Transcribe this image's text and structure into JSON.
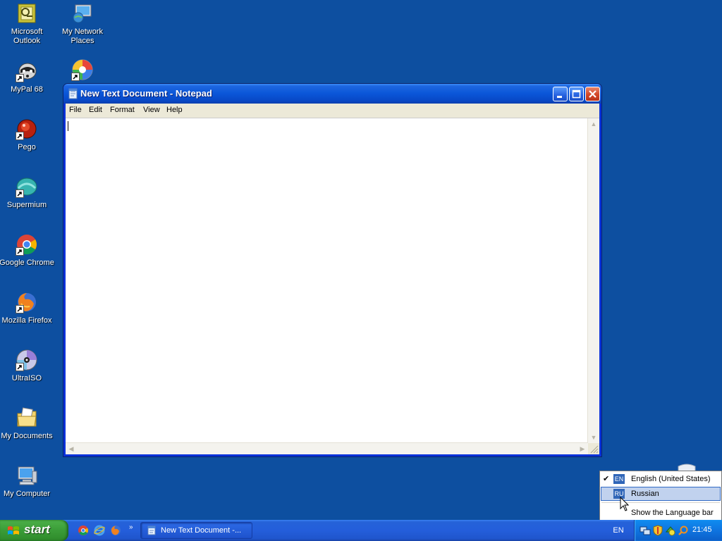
{
  "desktop": {
    "icons": [
      {
        "label": "Microsoft\nOutlook"
      },
      {
        "label": "My Network\nPlaces"
      },
      {
        "label": "MyPal 68"
      },
      {
        "label": ""
      },
      {
        "label": "Pego"
      },
      {
        "label": "Supermium"
      },
      {
        "label": "Google Chrome"
      },
      {
        "label": "Mozilla Firefox"
      },
      {
        "label": "UltraISO"
      },
      {
        "label": "My Documents"
      },
      {
        "label": "My Computer"
      }
    ]
  },
  "notepad": {
    "title": "New Text Document - Notepad",
    "menu": [
      "File",
      "Edit",
      "Format",
      "View",
      "Help"
    ],
    "content": ""
  },
  "language_menu": {
    "items": [
      {
        "badge": "EN",
        "label": "English (United States)",
        "checked": true
      },
      {
        "badge": "RU",
        "label": "Russian",
        "checked": false
      },
      {
        "badge": "",
        "label": "Show the Language bar",
        "checked": false
      }
    ]
  },
  "taskbar": {
    "start_label": "start",
    "quick_launch": [
      "chrome-icon",
      "internet-explorer-icon",
      "firefox-icon"
    ],
    "tasks": [
      {
        "label": "New Text Document -..."
      }
    ],
    "language_indicator": "EN",
    "clock": "21:45"
  }
}
